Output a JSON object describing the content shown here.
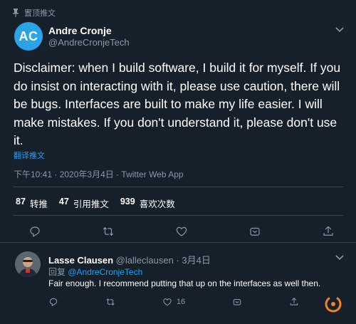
{
  "pinned_label": "置顶推文",
  "author": {
    "avatar_initials": "AC",
    "avatar_color": "#2aa4e6",
    "name": "Andre Cronje",
    "handle": "@AndreCronjeTech"
  },
  "tweet": {
    "text": "Disclaimer: when I build software, I build it for myself. If you do insist on interacting with it, please use caution, there will be bugs. Interfaces are built to make my life easier. I will make mistakes. If you don't understand it, please don't use it.",
    "translate_label": "翻译推文",
    "meta": "下午10:41 · 2020年3月4日 · Twitter Web App"
  },
  "stats": {
    "retweets_count": "87",
    "retweets_label": "转推",
    "quotes_count": "47",
    "quotes_label": "引用推文",
    "likes_count": "939",
    "likes_label": "喜欢次数"
  },
  "actions": [
    "reply-icon",
    "retweet-icon",
    "like-icon",
    "share-icon",
    "analytics-icon"
  ],
  "reply": {
    "name": "Lasse Clausen",
    "handle_date": "@lalleclausen · 3月4日",
    "replying_prefix": "回复",
    "replying_to": "@AndreCronjeTech",
    "text": "Fair enough. I recommend putting that up on the interfaces as well then.",
    "like_count": "16"
  },
  "colors": {
    "background": "#15202b",
    "accent": "#1da1f2",
    "muted": "#8899a6",
    "divider": "#38444d",
    "spinner": "#f5821f"
  }
}
